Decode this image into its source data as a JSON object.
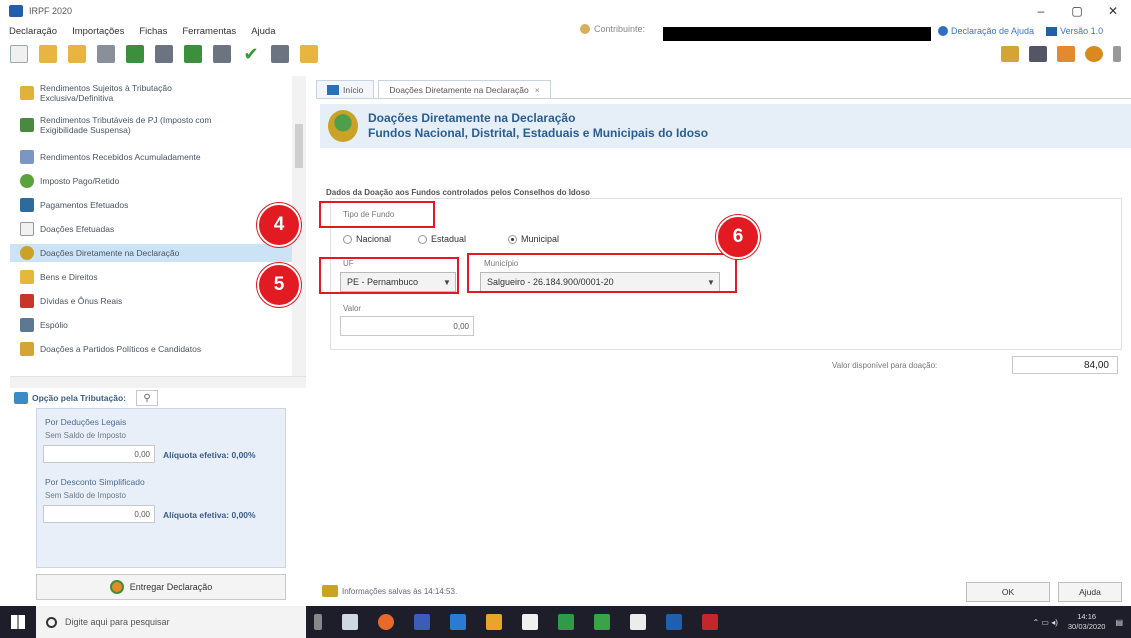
{
  "window": {
    "title": "IRPF 2020",
    "minimize": "–",
    "maximize": "▢",
    "close": "✕"
  },
  "menu": {
    "items": [
      "Declaração",
      "Importações",
      "Fichas",
      "Ferramentas",
      "Ajuda"
    ],
    "contribuinte_label": "Contribuinte:",
    "help_link": "Declaração de Ajuda",
    "version_link": "Versão 1.0"
  },
  "sidebar": {
    "items": [
      {
        "label": "Rendimentos Sujeitos à Tributação Exclusiva/Definitiva",
        "icon": "money-icon"
      },
      {
        "label": "Rendimentos Tributáveis de PJ (Imposto com Exigibilidade Suspensa)",
        "icon": "money-suspended-icon"
      },
      {
        "label": "Rendimentos Recebidos Acumuladamente",
        "icon": "accumulated-income-icon"
      },
      {
        "label": "Imposto Pago/Retido",
        "icon": "tax-paid-icon"
      },
      {
        "label": "Pagamentos Efetuados",
        "icon": "payments-icon"
      },
      {
        "label": "Doações Efetuadas",
        "icon": "donations-icon"
      },
      {
        "label": "Doações Diretamente na Declaração",
        "icon": "direct-donation-icon"
      },
      {
        "label": "Bens e Direitos",
        "icon": "assets-icon"
      },
      {
        "label": "Dívidas e Ônus Reais",
        "icon": "debts-icon"
      },
      {
        "label": "Espólio",
        "icon": "estate-icon"
      },
      {
        "label": "Doações a Partidos Políticos e Candidatos",
        "icon": "political-donation-icon"
      }
    ]
  },
  "options": {
    "header": "Opção pela Tributação:",
    "deducoes_label": "Por Deduções Legais",
    "deducoes_sub": "Sem Saldo de Imposto",
    "deducoes_value": "0,00",
    "deducoes_aliquota": "Alíquota efetiva: 0,00%",
    "simplificado_label": "Por Desconto Simplificado",
    "simplificado_sub": "Sem Saldo de Imposto",
    "simplificado_value": "0,00",
    "simplificado_aliquota": "Alíquota efetiva: 0,00%",
    "deliver_button": "Entregar Declaração"
  },
  "tabs": [
    {
      "label": "Início"
    },
    {
      "label": "Doações Diretamente na Declaração",
      "close": "×"
    }
  ],
  "main": {
    "title_line1": "Doações Diretamente na Declaração",
    "title_line2": "Fundos Nacional, Distrital, Estaduais e Municipais do Idoso",
    "section_title": "Dados da Doação aos Fundos controlados pelos Conselhos do Idoso",
    "tipo_fundo_label": "Tipo de Fundo",
    "radio_options": [
      "Nacional",
      "Estadual",
      "Municipal"
    ],
    "radio_selected": "Municipal",
    "uf_label": "UF",
    "uf_value": "PE - Pernambuco",
    "municipio_label": "Município",
    "municipio_value": "Salgueiro - 26.184.900/0001-20",
    "valor_label": "Valor",
    "valor_value": "0,00",
    "disponivel_label": "Valor disponível para doação:",
    "disponivel_value": "84,00"
  },
  "annotations": [
    "4",
    "5",
    "6"
  ],
  "status": {
    "text": "Informações salvas às 14:14:53.",
    "ok": "OK",
    "help": "Ajuda"
  },
  "taskbar": {
    "search_placeholder": "Digite aqui para pesquisar",
    "time": "14:16",
    "date": "30/03/2020"
  }
}
